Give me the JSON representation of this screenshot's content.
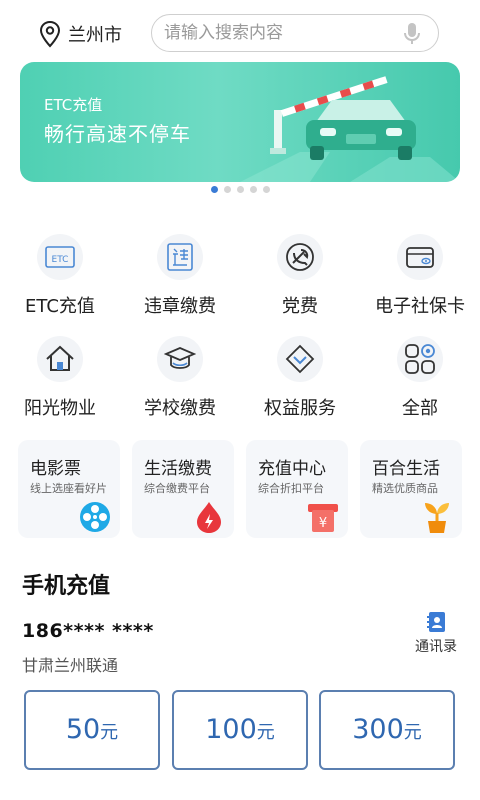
{
  "location": {
    "city": "兰州市",
    "icon": "location-pin-icon"
  },
  "search": {
    "placeholder": "请输入搜索内容",
    "value": "",
    "icon": "microphone-icon"
  },
  "banner": {
    "subtitle": "ETC充值",
    "title": "畅行高速不停车",
    "carousel": {
      "total": 5,
      "active_index": 0
    }
  },
  "services": [
    {
      "label": "ETC充值",
      "icon": "etc-icon"
    },
    {
      "label": "违章缴费",
      "icon": "violation-icon"
    },
    {
      "label": "党费",
      "icon": "party-emblem-icon"
    },
    {
      "label": "电子社保卡",
      "icon": "social-security-card-icon"
    },
    {
      "label": "阳光物业",
      "icon": "house-icon"
    },
    {
      "label": "学校缴费",
      "icon": "graduation-cap-icon"
    },
    {
      "label": "权益服务",
      "icon": "benefits-icon"
    },
    {
      "label": "全部",
      "icon": "all-apps-icon"
    }
  ],
  "cards": [
    {
      "title": "电影票",
      "subtitle": "线上选座看好片",
      "icon": "film-reel-icon",
      "color": "#1fa9e6"
    },
    {
      "title": "生活缴费",
      "subtitle": "综合缴费平台",
      "icon": "flame-icon",
      "color": "#e8363c"
    },
    {
      "title": "充值中心",
      "subtitle": "综合折扣平台",
      "icon": "recharge-icon",
      "color": "#f0504a"
    },
    {
      "title": "百合生活",
      "subtitle": "精选优质商品",
      "icon": "plant-icon",
      "color": "#f7a21b"
    }
  ],
  "recharge": {
    "section_title": "手机充值",
    "phone_number": "186**** ****",
    "carrier": "甘肃兰州联通",
    "contacts_label": "通讯录",
    "amounts": [
      {
        "value": "50",
        "unit": "元"
      },
      {
        "value": "100",
        "unit": "元"
      },
      {
        "value": "300",
        "unit": "元"
      }
    ]
  },
  "colors": {
    "accent": "#3a7bd5",
    "banner": "#4fd0b3",
    "amount_border": "#5b7fb0",
    "amount_text": "#2f67b0"
  }
}
